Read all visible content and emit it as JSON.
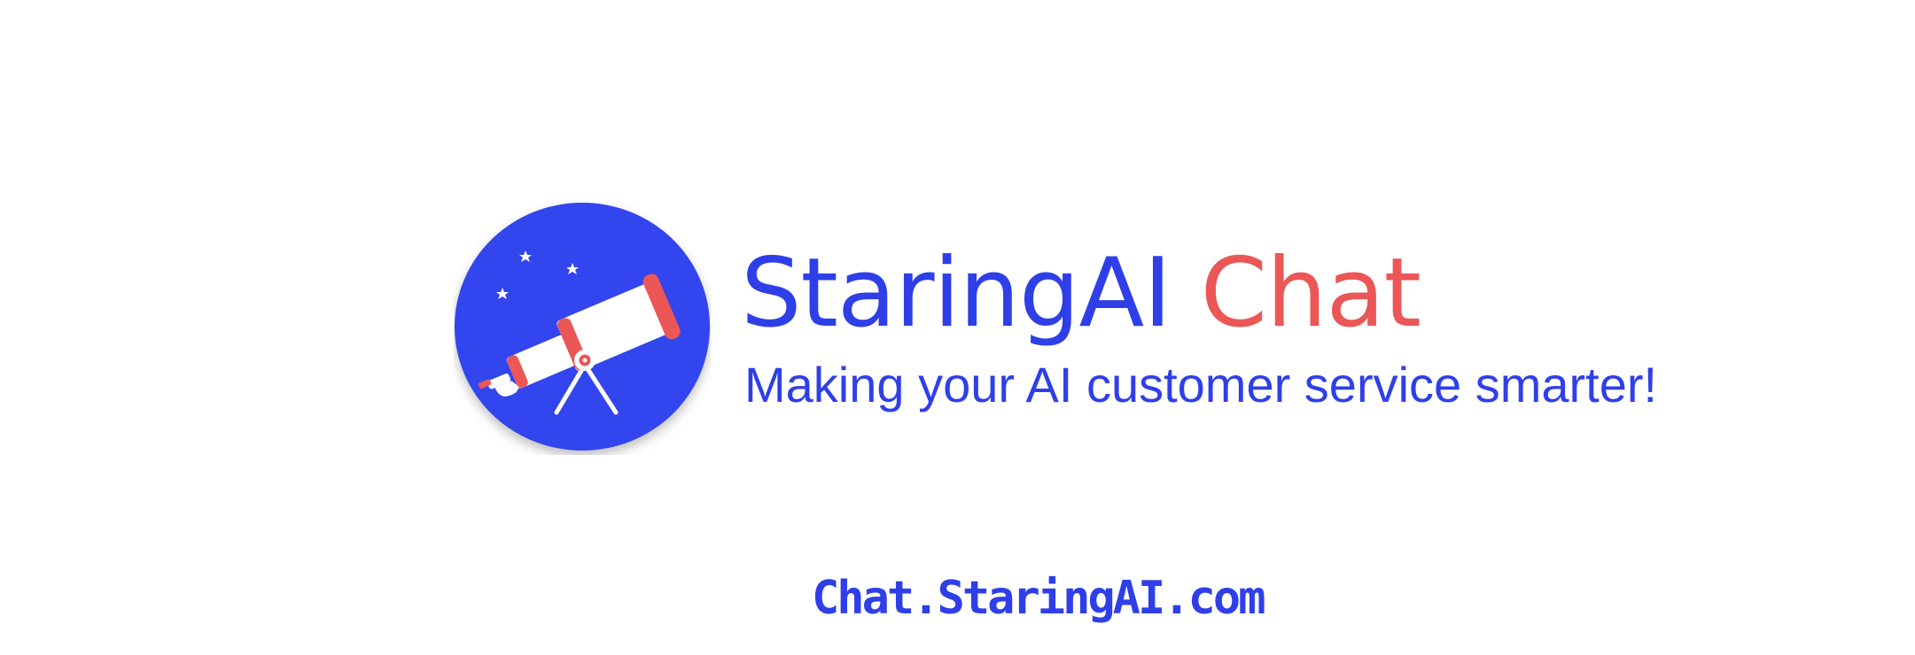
{
  "brand": {
    "name": "StaringAI",
    "accent_word": "Chat",
    "tagline": "Making your AI customer service smarter!",
    "url": "Chat.StaringAI.com"
  },
  "logo": {
    "icon": "telescope-icon",
    "circle_color": "#3344ee",
    "accent_color": "#eb5656",
    "tube_color": "#ffffff"
  },
  "colors": {
    "primary": "#2f3fe8",
    "accent": "#eb5656",
    "background": "#ffffff"
  }
}
